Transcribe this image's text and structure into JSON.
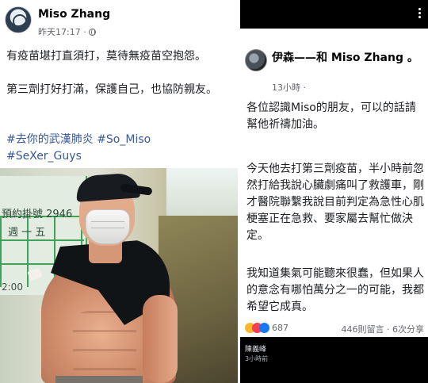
{
  "left_post": {
    "author": "Miso Zhang",
    "timestamp": "昨天17:17 ·",
    "paragraph1": "有疫苗堪打直須打，莫待無疫苗空抱怨。",
    "paragraph2": "第三劑打好打滿，保護自己，也協防親友。",
    "hashtags": [
      "#去你的武漢肺炎",
      "#So_Miso",
      "#SeXer_Guys"
    ],
    "photo": {
      "sign_text": "預約掛號 2946",
      "sign_text2": "週 一 五",
      "clock_text": "2:00"
    }
  },
  "right_post": {
    "author": "伊森——和 Miso Zhang 。",
    "timestamp": "13小時 ·",
    "paragraph1": "各位認識Miso的朋友，可以的話請幫他祈禱加油。",
    "paragraph2": "今天他去打第三劑疫苗，半小時前忽然打給我說心臟劇痛叫了救護車，剛才醫院聯繫我說目前判定為急性心肌梗塞正在急救、要家屬去幫忙做決定。",
    "paragraph3": "我知道集氣可能聽來很蠢，但如果人的意念有哪怕萬分之一的可能，我都希望它成真。",
    "reaction_count": "687",
    "stats": "446則留言 · 6次分享",
    "comment_author": "陳義峰",
    "comment_time": "3小時前"
  },
  "colors": {
    "link": "#385898",
    "secondary_text": "#65676b",
    "dark_bar": "#000000"
  },
  "icons": [
    "globe-icon",
    "more-options-icon",
    "like-reaction-icon",
    "love-reaction-icon",
    "haha-reaction-icon"
  ]
}
